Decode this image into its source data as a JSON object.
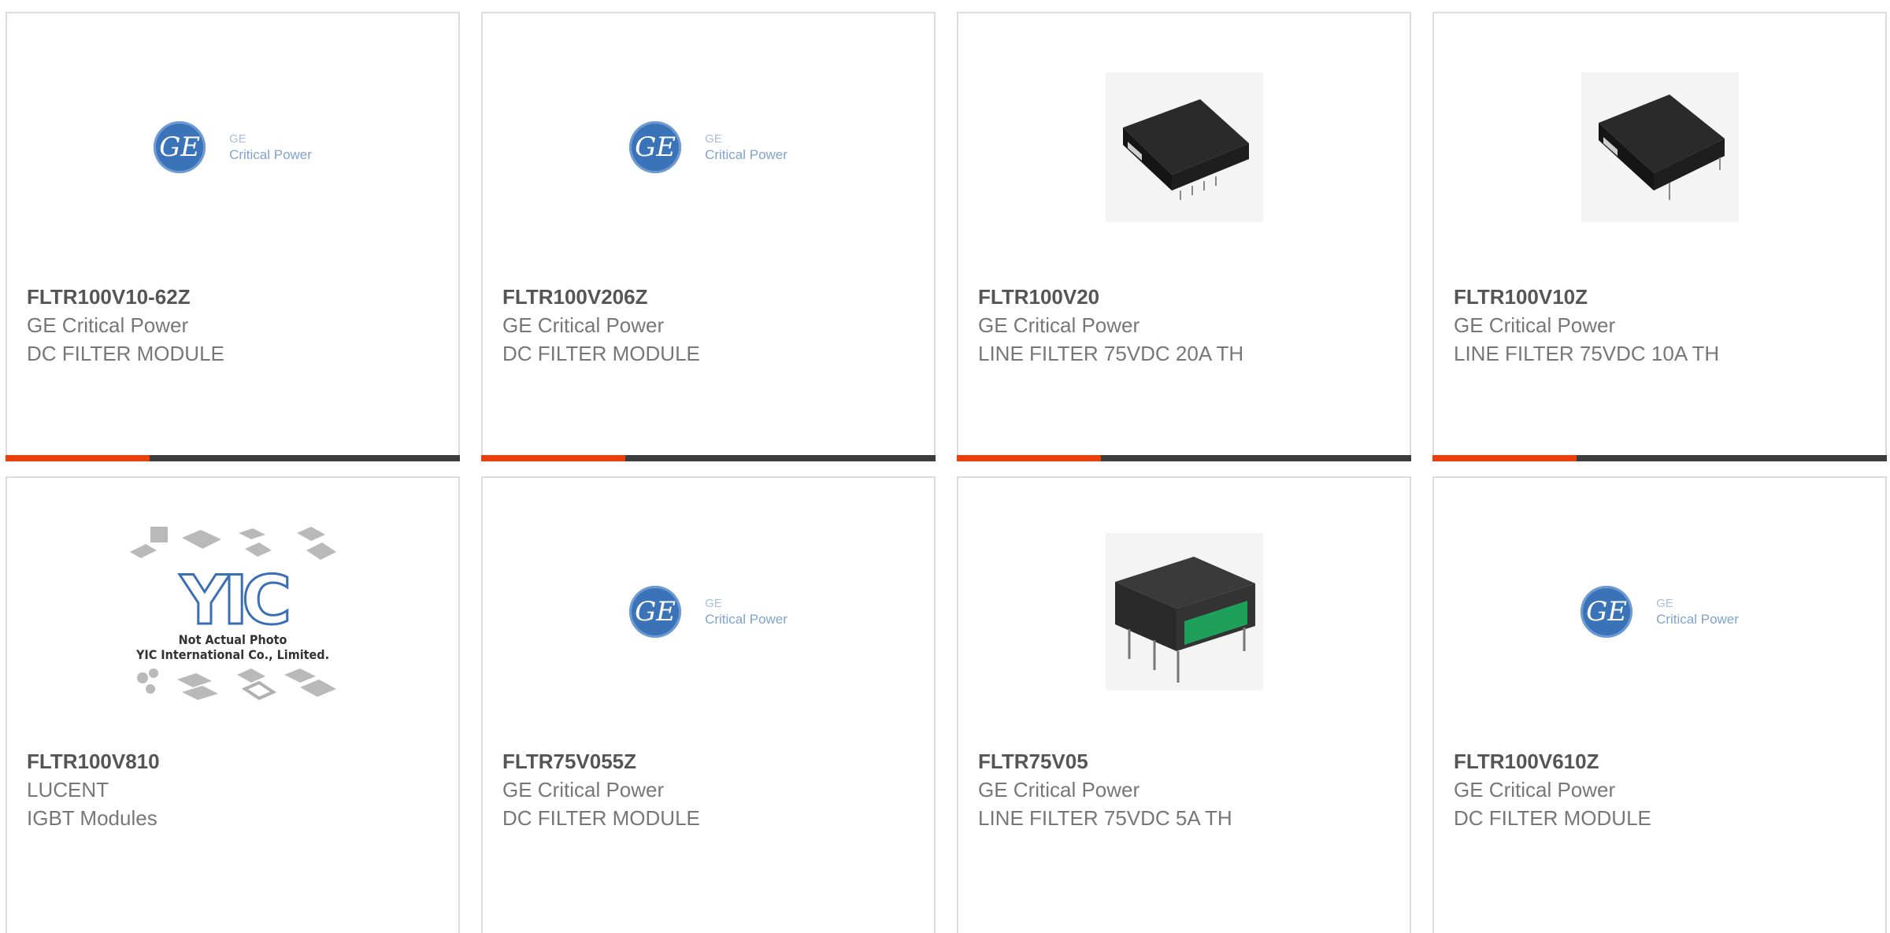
{
  "colors": {
    "accent": "#e8400c",
    "bar": "#3d3d3d",
    "border": "#dcdcdc"
  },
  "ge_logo": {
    "brand": "GE",
    "line1": "Critical Power"
  },
  "yic": {
    "caption1": "Not Actual Photo",
    "caption2": "YIC International Co., Limited."
  },
  "cards": [
    {
      "part": "FLTR100V10-62Z",
      "manufacturer": "GE Critical Power",
      "description": "DC FILTER MODULE",
      "image": "ge-logo"
    },
    {
      "part": "FLTR100V206Z",
      "manufacturer": "GE Critical Power",
      "description": "DC FILTER MODULE",
      "image": "ge-logo"
    },
    {
      "part": "FLTR100V20",
      "manufacturer": "GE Critical Power",
      "description": "LINE FILTER 75VDC 20A TH",
      "image": "black-module"
    },
    {
      "part": "FLTR100V10Z",
      "manufacturer": "GE Critical Power",
      "description": "LINE FILTER 75VDC 10A TH",
      "image": "black-module"
    },
    {
      "part": "FLTR100V810",
      "manufacturer": "LUCENT",
      "description": "IGBT Modules",
      "image": "yic-placeholder"
    },
    {
      "part": "FLTR75V055Z",
      "manufacturer": "GE Critical Power",
      "description": "DC FILTER MODULE",
      "image": "ge-logo"
    },
    {
      "part": "FLTR75V05",
      "manufacturer": "GE Critical Power",
      "description": "LINE FILTER 75VDC 5A TH",
      "image": "green-module"
    },
    {
      "part": "FLTR100V610Z",
      "manufacturer": "GE Critical Power",
      "description": "DC FILTER MODULE",
      "image": "ge-logo"
    }
  ]
}
